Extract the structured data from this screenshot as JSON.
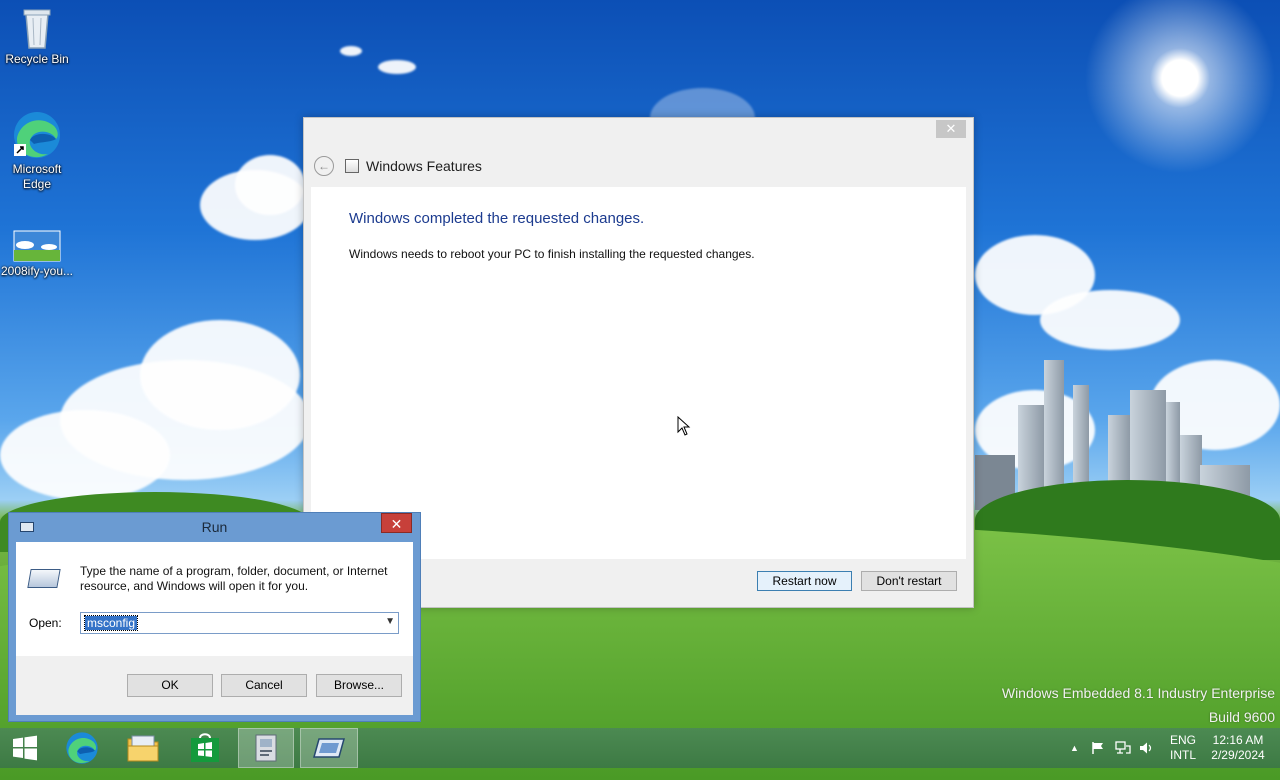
{
  "desktop": {
    "icons": [
      {
        "label": "Recycle Bin",
        "icon": "recycle-bin-icon"
      },
      {
        "label": "Microsoft Edge",
        "icon": "edge-icon"
      },
      {
        "label": "2008ify-you...",
        "icon": "image-file-icon"
      }
    ],
    "watermark_line1": "Windows Embedded 8.1 Industry Enterprise",
    "watermark_line2": "Build 9600"
  },
  "windows_features": {
    "title": "Windows Features",
    "heading": "Windows completed the requested changes.",
    "message": "Windows needs to reboot your PC to finish installing the requested changes.",
    "restart_now": "Restart now",
    "dont_restart": "Don't restart",
    "close_glyph": "✕",
    "back_glyph": "←"
  },
  "run_dialog": {
    "title": "Run",
    "description": "Type the name of a program, folder, document, or Internet resource, and Windows will open it for you.",
    "open_label": "Open:",
    "open_value": "msconfig",
    "ok": "OK",
    "cancel": "Cancel",
    "browse": "Browse...",
    "close_glyph": "✕"
  },
  "taskbar": {
    "items": [
      "start-button",
      "edge",
      "file-explorer",
      "store",
      "windows-features",
      "run"
    ],
    "lang_line1": "ENG",
    "lang_line2": "INTL",
    "time": "12:16 AM",
    "date": "2/29/2024"
  },
  "colors": {
    "heading_blue": "#1c3b8f",
    "run_frame": "#6b9bd2",
    "run_close": "#c7403a",
    "taskbar": "#3d7a44"
  }
}
